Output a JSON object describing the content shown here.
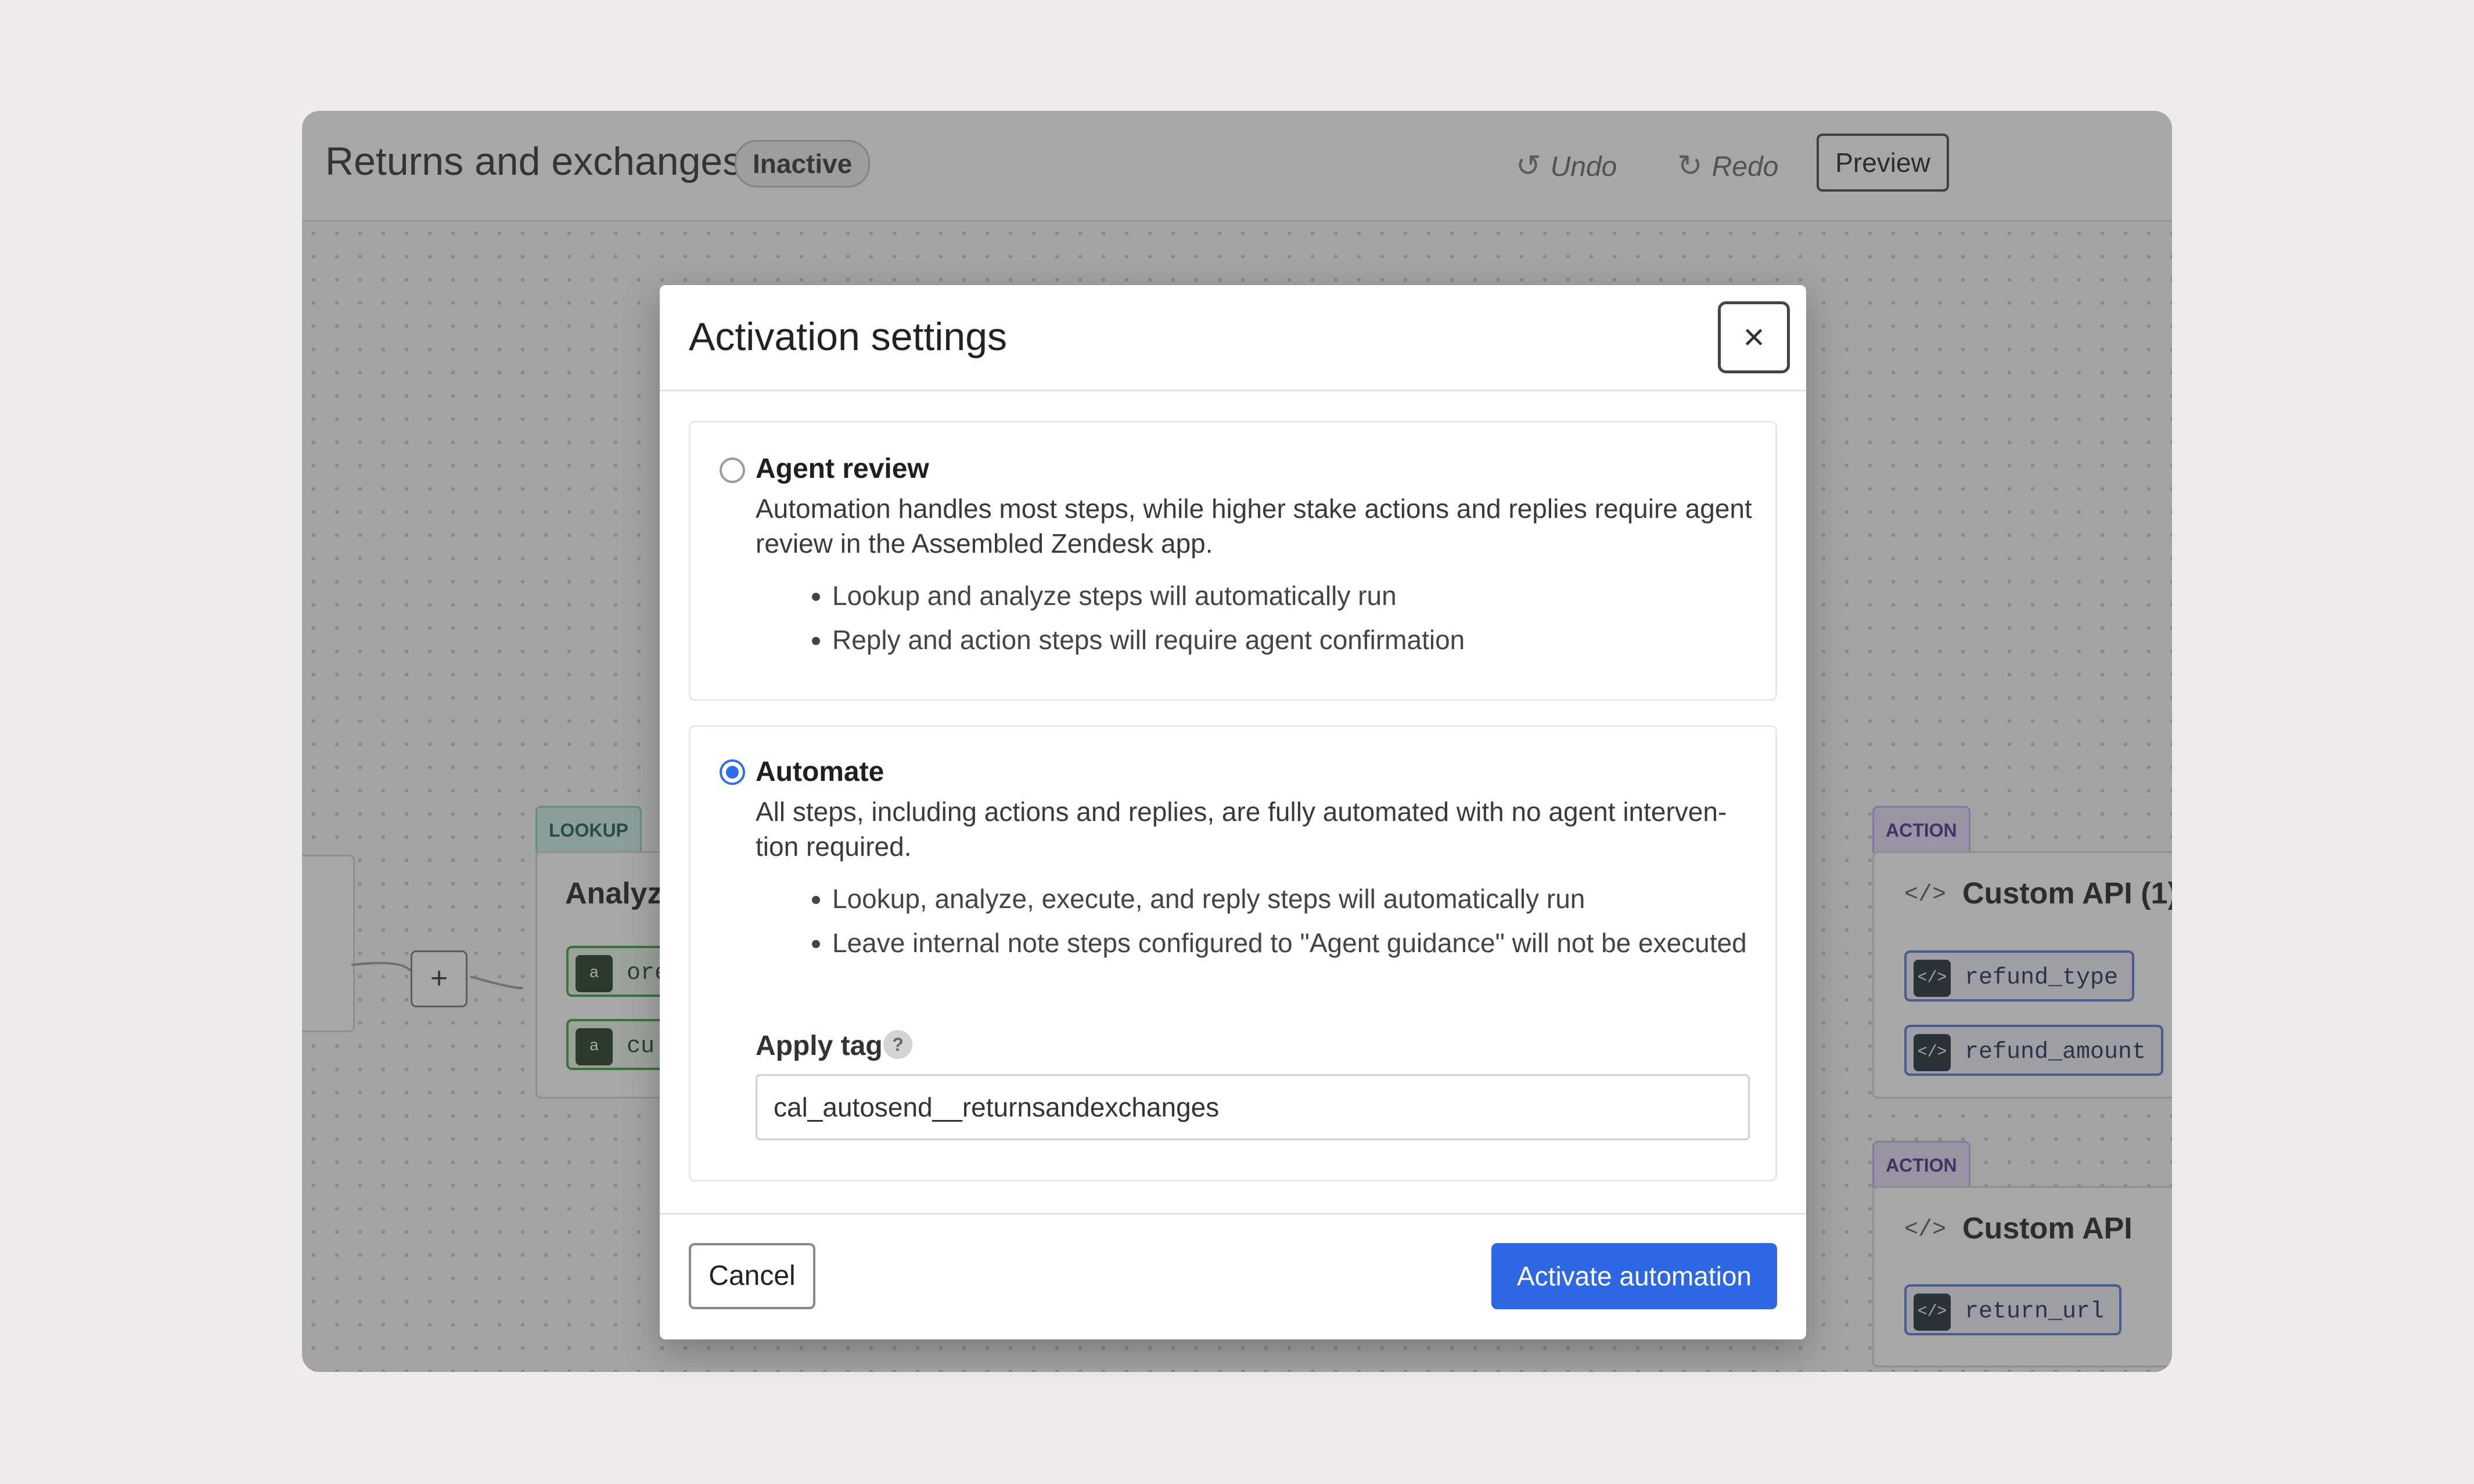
{
  "header": {
    "title": "Returns and exchanges",
    "status_badge": "Inactive",
    "undo_label": "Undo",
    "redo_label": "Redo",
    "preview_label": "Preview"
  },
  "canvas": {
    "plus_label": "+",
    "lookup_node": {
      "tag": "LOOKUP",
      "title": "Analyz",
      "chips": [
        "ore",
        "cu:"
      ]
    },
    "action_node_1": {
      "tag": "ACTION",
      "title": "Custom API (1)",
      "chips": [
        "refund_type",
        "refund_amount"
      ]
    },
    "action_node_2": {
      "tag": "ACTION",
      "title": "Custom API",
      "chips": [
        "return_url"
      ]
    },
    "code_icon": "</>"
  },
  "modal": {
    "title": "Activation settings",
    "close_icon": "×",
    "agent_review": {
      "label": "Agent review",
      "description": "Automation handles most steps, while higher stake actions and replies require agent review in the Assembled Zendesk app.",
      "bullets": [
        "Lookup and analyze steps will automatically run",
        "Reply and action steps will require agent confirmation"
      ],
      "selected": false
    },
    "automate": {
      "label": "Automate",
      "description": "All steps, including actions and replies, are fully automated with no agent interven-tion required.",
      "bullets": [
        "Lookup, analyze, execute, and reply steps will automatically run",
        "Leave internal note steps configured to \"Agent guidance\" will not be executed"
      ],
      "selected": true,
      "apply_tag_label": "Apply tag",
      "help_icon": "?",
      "tag_value": "cal_autosend__returnsandexchanges"
    },
    "cancel_label": "Cancel",
    "activate_label": "Activate automation"
  },
  "colors": {
    "primary": "#2e67e3",
    "radio_selected": "#2f6df0",
    "lookup_tag": "#cdeee8",
    "action_tag": "#e6daf7"
  }
}
